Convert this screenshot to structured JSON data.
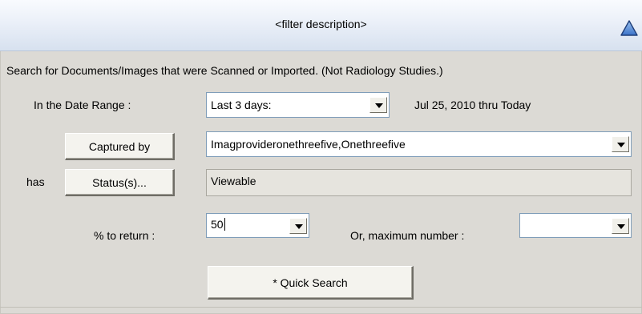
{
  "header": {
    "title": "<filter description>",
    "collapse_icon": "triangle-up-icon"
  },
  "description": "Search for Documents/Images that were Scanned or Imported.  (Not Radiology Studies.)",
  "date_range": {
    "label": "In the Date Range :",
    "selected": "Last 3 days:",
    "range_text": "Jul 25, 2010 thru Today"
  },
  "captured_by": {
    "button_label": "Captured by",
    "selected": "Imagprovideronethreefive,Onethreefive"
  },
  "status": {
    "prefix": "has",
    "button_label": "Status(s)...",
    "value": "Viewable"
  },
  "percent": {
    "label": "% to return :",
    "value": "50"
  },
  "maximum": {
    "label": "Or,  maximum number :",
    "value": ""
  },
  "quick_search": {
    "label": "* Quick Search"
  },
  "colors": {
    "panel_bg": "#dcdad5",
    "header_gradient_top": "#f9fbfe",
    "header_gradient_bottom": "#d7e1ef",
    "collapse_icon_fill": "#4a82d4",
    "combo_border": "#7f9db9"
  }
}
